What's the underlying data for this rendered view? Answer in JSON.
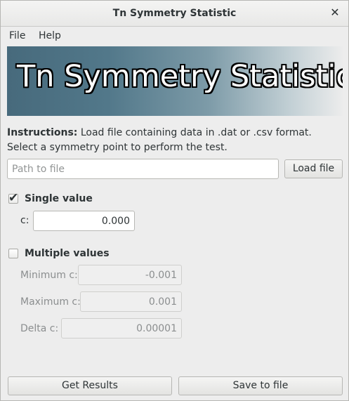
{
  "window": {
    "title": "Tn Symmetry Statistic",
    "close_glyph": "✕"
  },
  "menu": {
    "items": [
      {
        "label": "File"
      },
      {
        "label": "Help"
      }
    ]
  },
  "banner": {
    "text": "Tn Symmetry Statistic"
  },
  "instructions": {
    "label": "Instructions:",
    "text": " Load file containing data in .dat or .csv format. Select a symmetry point to perform the test."
  },
  "file": {
    "path_value": "",
    "path_placeholder": "Path to file",
    "load_label": "Load file"
  },
  "single": {
    "checked": true,
    "label": "Single value",
    "c_label": "c:",
    "c_value": "0.000"
  },
  "multiple": {
    "checked": false,
    "label": "Multiple values",
    "min_label": "Minimum c:",
    "min_value": "-0.001",
    "max_label": "Maximum c:",
    "max_value": "0.001",
    "delta_label": "Delta c:",
    "delta_value": "0.00001"
  },
  "actions": {
    "get_results_label": "Get Results",
    "save_label": "Save to file"
  },
  "icons": {
    "checkmark": "✔"
  }
}
